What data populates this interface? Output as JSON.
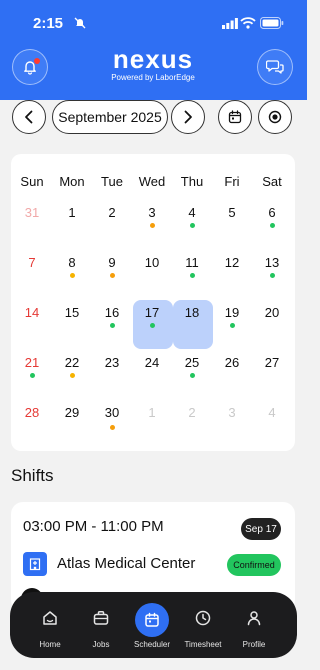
{
  "status_bar": {
    "time": "2:15"
  },
  "header": {
    "logo_text": "nexus",
    "logo_subtitle": "Powered by LaborEdge",
    "colors": {
      "brand_blue": "#2f6ff3"
    }
  },
  "month_nav": {
    "month_label": "September 2025"
  },
  "calendar": {
    "weekdays": [
      "Sun",
      "Mon",
      "Tue",
      "Wed",
      "Thu",
      "Fri",
      "Sat"
    ],
    "weeks": [
      [
        "31",
        "1",
        "2",
        "3",
        "4",
        "5",
        "6"
      ],
      [
        "7",
        "8",
        "9",
        "10",
        "11",
        "12",
        "13"
      ],
      [
        "14",
        "15",
        "16",
        "17",
        "18",
        "19",
        "20"
      ],
      [
        "21",
        "22",
        "23",
        "24",
        "25",
        "26",
        "27"
      ],
      [
        "28",
        "29",
        "30",
        "1",
        "2",
        "3",
        "4"
      ]
    ],
    "selected_days": [
      "17",
      "18"
    ],
    "dot_colors": {
      "green": "#22c55e",
      "orange": "#f59e0b",
      "amber": "#f6b300"
    }
  },
  "shifts": {
    "title": "Shifts",
    "card": {
      "time": "03:00 PM - 11:00 PM",
      "date_badge": "Sep 17",
      "facility": "Atlas Medical Center",
      "status": "Confirmed"
    }
  },
  "tabbar": {
    "tabs": [
      {
        "label": "Home",
        "icon": "home-icon"
      },
      {
        "label": "Jobs",
        "icon": "briefcase-icon"
      },
      {
        "label": "Scheduler",
        "icon": "calendar-icon",
        "active": true
      },
      {
        "label": "Timesheet",
        "icon": "clock-icon"
      },
      {
        "label": "Profile",
        "icon": "person-icon"
      }
    ]
  }
}
